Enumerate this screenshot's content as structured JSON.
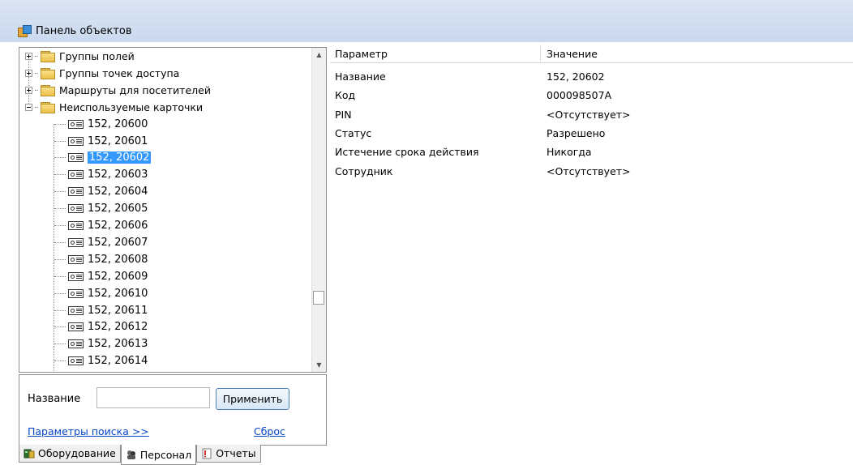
{
  "window": {
    "title": "Панель объектов",
    "icon": "object-panel-icon"
  },
  "tree": {
    "groups": [
      {
        "label": "Группы полей",
        "expanded": false
      },
      {
        "label": "Группы точек доступа",
        "expanded": false
      },
      {
        "label": "Маршруты для посетителей",
        "expanded": false
      },
      {
        "label": "Неиспользуемые карточки",
        "expanded": true
      }
    ],
    "cards": [
      "152, 20600",
      "152, 20601",
      "152, 20602",
      "152, 20603",
      "152, 20604",
      "152, 20605",
      "152, 20606",
      "152, 20607",
      "152, 20608",
      "152, 20609",
      "152, 20610",
      "152, 20611",
      "152, 20612",
      "152, 20613",
      "152, 20614"
    ],
    "selected_index": 2
  },
  "search": {
    "name_label": "Название",
    "name_value": "",
    "apply_label": "Применить",
    "params_link": "Параметры поиска >>",
    "reset_link": "Сброс"
  },
  "tabs": [
    {
      "label": "Оборудование",
      "icon": "equipment-icon",
      "active": false
    },
    {
      "label": "Персонал",
      "icon": "personnel-icon",
      "active": true
    },
    {
      "label": "Отчеты",
      "icon": "reports-icon",
      "active": false
    }
  ],
  "properties": {
    "header": {
      "param": "Параметр",
      "value": "Значение"
    },
    "rows": [
      {
        "param": "Название",
        "value": "152, 20602"
      },
      {
        "param": "Код",
        "value": "000098507A"
      },
      {
        "param": "PIN",
        "value": "<Отсутствует>"
      },
      {
        "param": "Статус",
        "value": "Разрешено"
      },
      {
        "param": "Истечение срока действия",
        "value": "Никогда"
      },
      {
        "param": "Сотрудник",
        "value": "<Отсутствует>"
      }
    ]
  },
  "colors": {
    "selection": "#3399ff",
    "titlebar": "#c9d9ee",
    "link": "#0645c8"
  }
}
